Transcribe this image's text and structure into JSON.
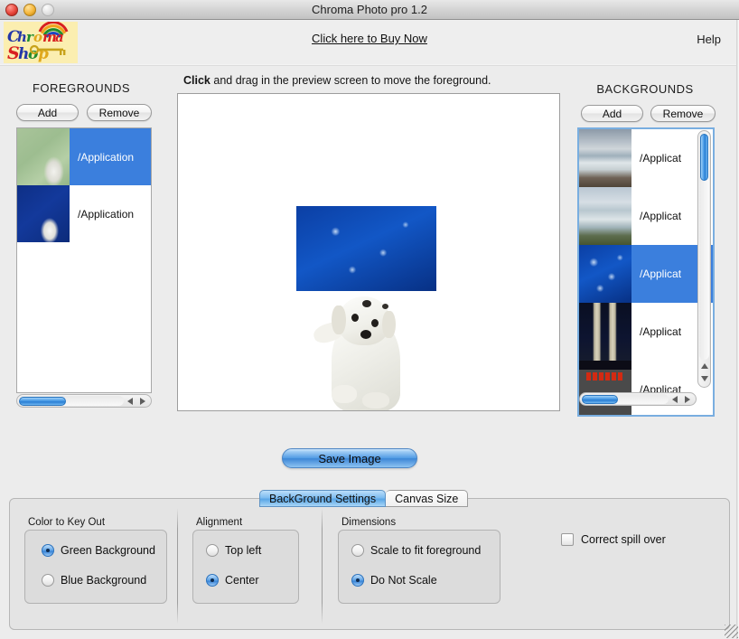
{
  "window": {
    "title": "Chroma Photo pro 1.2",
    "controls": [
      "close",
      "minimize",
      "zoom"
    ]
  },
  "header": {
    "logo_line1": "Chroma",
    "logo_line2": "Shop",
    "buy_link": "Click here to Buy Now",
    "help": "Help"
  },
  "foregrounds": {
    "title": "FOREGROUNDS",
    "add_label": "Add",
    "remove_label": "Remove",
    "items": [
      {
        "label": "/Application",
        "thumb": "dog-on-green",
        "selected": true
      },
      {
        "label": "/Application",
        "thumb": "dog-on-blue",
        "selected": false
      }
    ]
  },
  "backgrounds": {
    "title": "BACKGROUNDS",
    "add_label": "Add",
    "remove_label": "Remove",
    "items": [
      {
        "label": "/Applicat",
        "thumb": "cliff-coast",
        "selected": false
      },
      {
        "label": "/Applicat",
        "thumb": "coastal-bay",
        "selected": false
      },
      {
        "label": "/Applicat",
        "thumb": "jellyfish",
        "selected": true
      },
      {
        "label": "/Applicat",
        "thumb": "petronas-towers",
        "selected": false
      },
      {
        "label": "/Applicat",
        "thumb": "dark-red-text",
        "selected": false
      }
    ]
  },
  "preview": {
    "hint_bold": "Click",
    "hint_rest": " and drag in the preview screen to move the foreground.",
    "background_image": "jellyfish",
    "foreground_image": "white-dog-keyed"
  },
  "save": {
    "label": "Save Image"
  },
  "tabs": [
    {
      "label": "BackGround Settings",
      "active": true
    },
    {
      "label": "Canvas Size",
      "active": false
    }
  ],
  "settings": {
    "color_to_key_out": {
      "label": "Color to Key Out",
      "options": [
        {
          "label": "Green Background",
          "selected": true
        },
        {
          "label": "Blue Background",
          "selected": false
        }
      ]
    },
    "alignment": {
      "label": "Alignment",
      "options": [
        {
          "label": "Top left",
          "selected": false
        },
        {
          "label": "Center",
          "selected": true
        }
      ]
    },
    "dimensions": {
      "label": "Dimensions",
      "options": [
        {
          "label": "Scale to fit foreground",
          "selected": false
        },
        {
          "label": "Do Not Scale",
          "selected": true
        }
      ]
    },
    "correct_spill_over": {
      "label": "Correct spill over",
      "checked": false
    }
  },
  "colors": {
    "selection_blue": "#3b7fdd",
    "accent_blue": "#4f9ae4",
    "window_bg": "#ececec",
    "panel_bg": "#e4e4e4",
    "groupbox_bg": "#dcdcdc"
  }
}
